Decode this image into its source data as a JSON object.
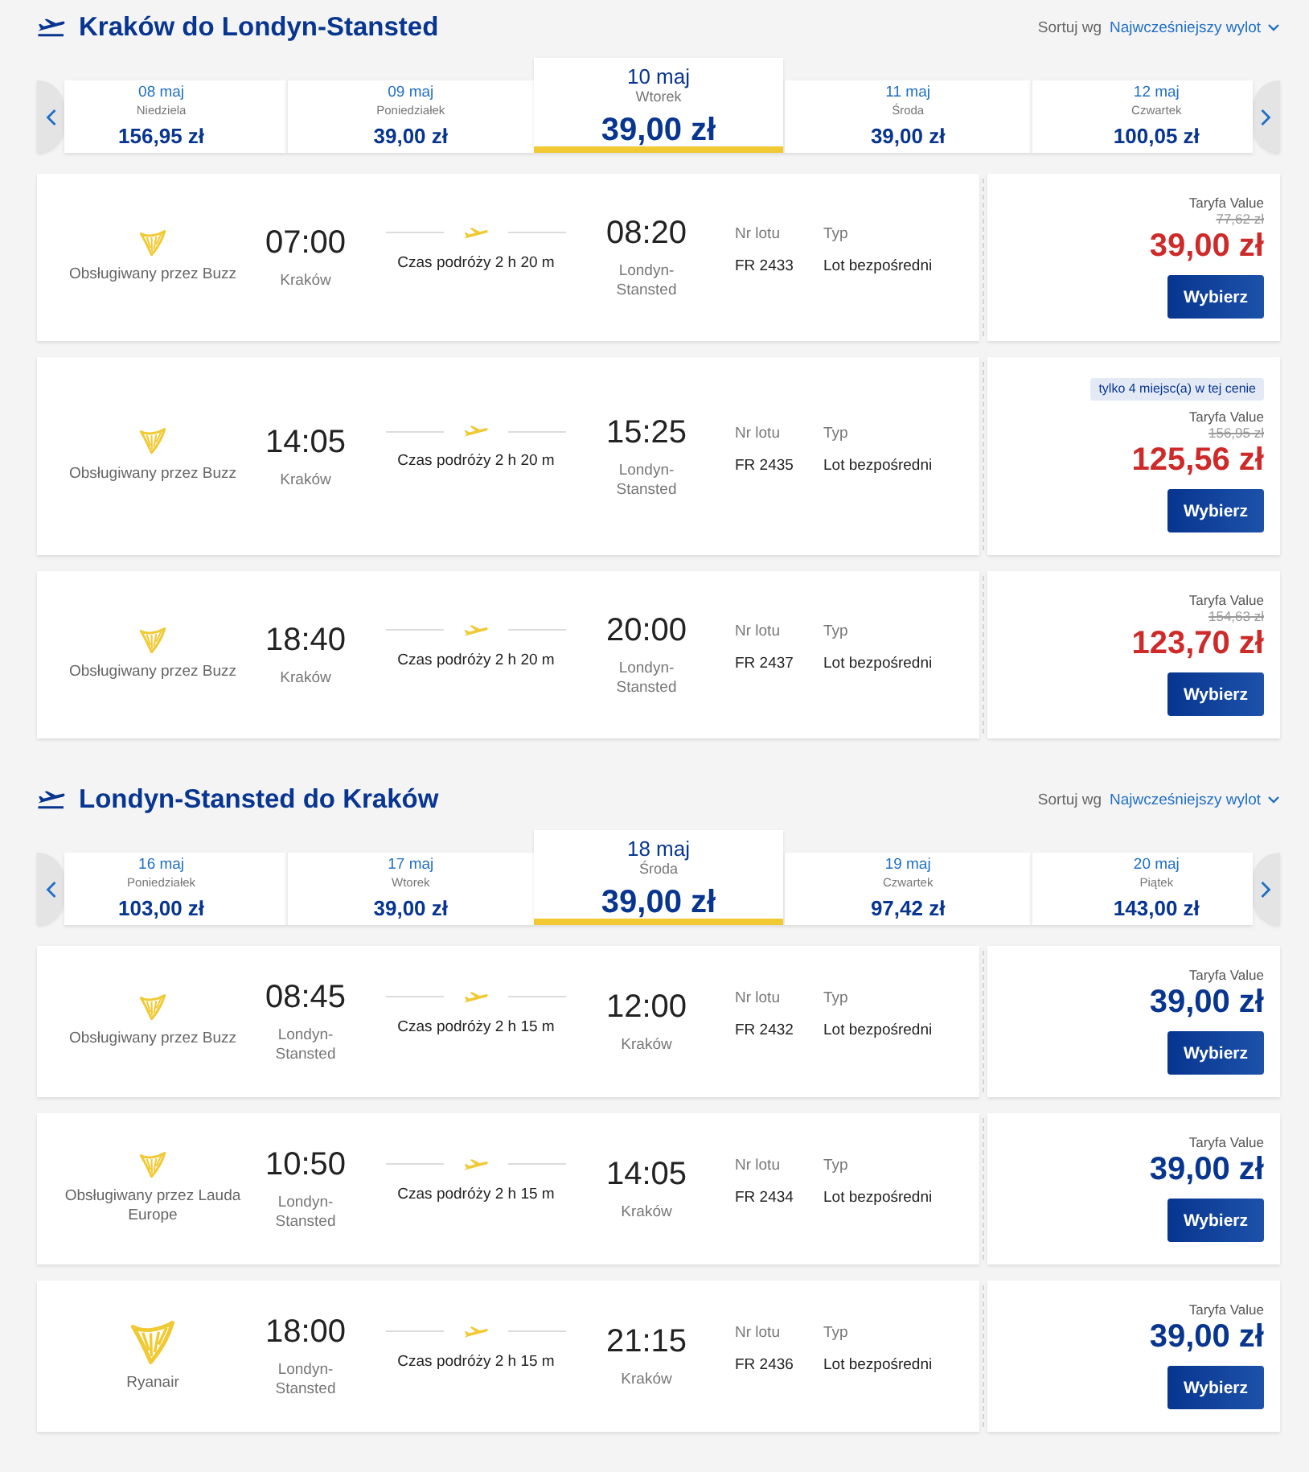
{
  "sections": [
    {
      "title": "Kraków do Londyn-Stansted",
      "sort": {
        "label": "Sortuj wg",
        "value": "Najwcześniejszy wylot"
      },
      "dates": [
        {
          "date": "08 maj",
          "day": "Niedziela",
          "price": "156,95 zł",
          "selected": false
        },
        {
          "date": "09 maj",
          "day": "Poniedziałek",
          "price": "39,00 zł",
          "selected": false
        },
        {
          "date": "10 maj",
          "day": "Wtorek",
          "price": "39,00 zł",
          "selected": true
        },
        {
          "date": "11 maj",
          "day": "Środa",
          "price": "39,00 zł",
          "selected": false
        },
        {
          "date": "12 maj",
          "day": "Czwartek",
          "price": "100,05 zł",
          "selected": false
        }
      ],
      "flights": [
        {
          "operator": {
            "kind": "partner",
            "name": "Obsługiwany przez Buzz"
          },
          "departure": {
            "time": "07:00",
            "airport": "Kraków"
          },
          "duration": "Czas podróży 2 h 20 m",
          "arrival": {
            "time": "08:20",
            "airport": "Londyn-Stansted"
          },
          "flight_number": {
            "label": "Nr lotu",
            "value": "FR 2433"
          },
          "type": {
            "label": "Typ",
            "value": "Lot bezpośredni"
          },
          "fare": {
            "name": "Taryfa Value",
            "old_price": "77,62 zł",
            "price": "39,00 zł",
            "button": "Wybierz"
          }
        },
        {
          "operator": {
            "kind": "partner",
            "name": "Obsługiwany przez Buzz"
          },
          "departure": {
            "time": "14:05",
            "airport": "Kraków"
          },
          "duration": "Czas podróży 2 h 20 m",
          "arrival": {
            "time": "15:25",
            "airport": "Londyn-Stansted"
          },
          "flight_number": {
            "label": "Nr lotu",
            "value": "FR 2435"
          },
          "type": {
            "label": "Typ",
            "value": "Lot bezpośredni"
          },
          "fare": {
            "badge": "tylko 4 miejsc(a) w tej cenie",
            "name": "Taryfa Value",
            "old_price": "156,95 zł",
            "price": "125,56 zł",
            "button": "Wybierz"
          }
        },
        {
          "operator": {
            "kind": "partner",
            "name": "Obsługiwany przez Buzz"
          },
          "departure": {
            "time": "18:40",
            "airport": "Kraków"
          },
          "duration": "Czas podróży 2 h 20 m",
          "arrival": {
            "time": "20:00",
            "airport": "Londyn-Stansted"
          },
          "flight_number": {
            "label": "Nr lotu",
            "value": "FR 2437"
          },
          "type": {
            "label": "Typ",
            "value": "Lot bezpośredni"
          },
          "fare": {
            "name": "Taryfa Value",
            "old_price": "154,63 zł",
            "price": "123,70 zł",
            "button": "Wybierz"
          }
        }
      ]
    },
    {
      "title": "Londyn-Stansted do Kraków",
      "sort": {
        "label": "Sortuj wg",
        "value": "Najwcześniejszy wylot"
      },
      "dates": [
        {
          "date": "16 maj",
          "day": "Poniedziałek",
          "price": "103,00 zł",
          "selected": false
        },
        {
          "date": "17 maj",
          "day": "Wtorek",
          "price": "39,00 zł",
          "selected": false
        },
        {
          "date": "18 maj",
          "day": "Środa",
          "price": "39,00 zł",
          "selected": true
        },
        {
          "date": "19 maj",
          "day": "Czwartek",
          "price": "97,42 zł",
          "selected": false
        },
        {
          "date": "20 maj",
          "day": "Piątek",
          "price": "143,00 zł",
          "selected": false
        }
      ],
      "flights": [
        {
          "operator": {
            "kind": "partner",
            "name": "Obsługiwany przez Buzz"
          },
          "departure": {
            "time": "08:45",
            "airport": "Londyn-Stansted"
          },
          "duration": "Czas podróży 2 h 15 m",
          "arrival": {
            "time": "12:00",
            "airport": "Kraków"
          },
          "flight_number": {
            "label": "Nr lotu",
            "value": "FR 2432"
          },
          "type": {
            "label": "Typ",
            "value": "Lot bezpośredni"
          },
          "fare": {
            "name": "Taryfa Value",
            "price": "39,00 zł",
            "button": "Wybierz"
          }
        },
        {
          "operator": {
            "kind": "partner",
            "name": "Obsługiwany przez Lauda Europe"
          },
          "departure": {
            "time": "10:50",
            "airport": "Londyn-Stansted"
          },
          "duration": "Czas podróży 2 h 15 m",
          "arrival": {
            "time": "14:05",
            "airport": "Kraków"
          },
          "flight_number": {
            "label": "Nr lotu",
            "value": "FR 2434"
          },
          "type": {
            "label": "Typ",
            "value": "Lot bezpośredni"
          },
          "fare": {
            "name": "Taryfa Value",
            "price": "39,00 zł",
            "button": "Wybierz"
          }
        },
        {
          "operator": {
            "kind": "own",
            "name": "Ryanair"
          },
          "departure": {
            "time": "18:00",
            "airport": "Londyn-Stansted"
          },
          "duration": "Czas podróży 2 h 15 m",
          "arrival": {
            "time": "21:15",
            "airport": "Kraków"
          },
          "flight_number": {
            "label": "Nr lotu",
            "value": "FR 2436"
          },
          "type": {
            "label": "Typ",
            "value": "Lot bezpośredni"
          },
          "fare": {
            "name": "Taryfa Value",
            "price": "39,00 zł",
            "button": "Wybierz"
          }
        }
      ]
    }
  ]
}
